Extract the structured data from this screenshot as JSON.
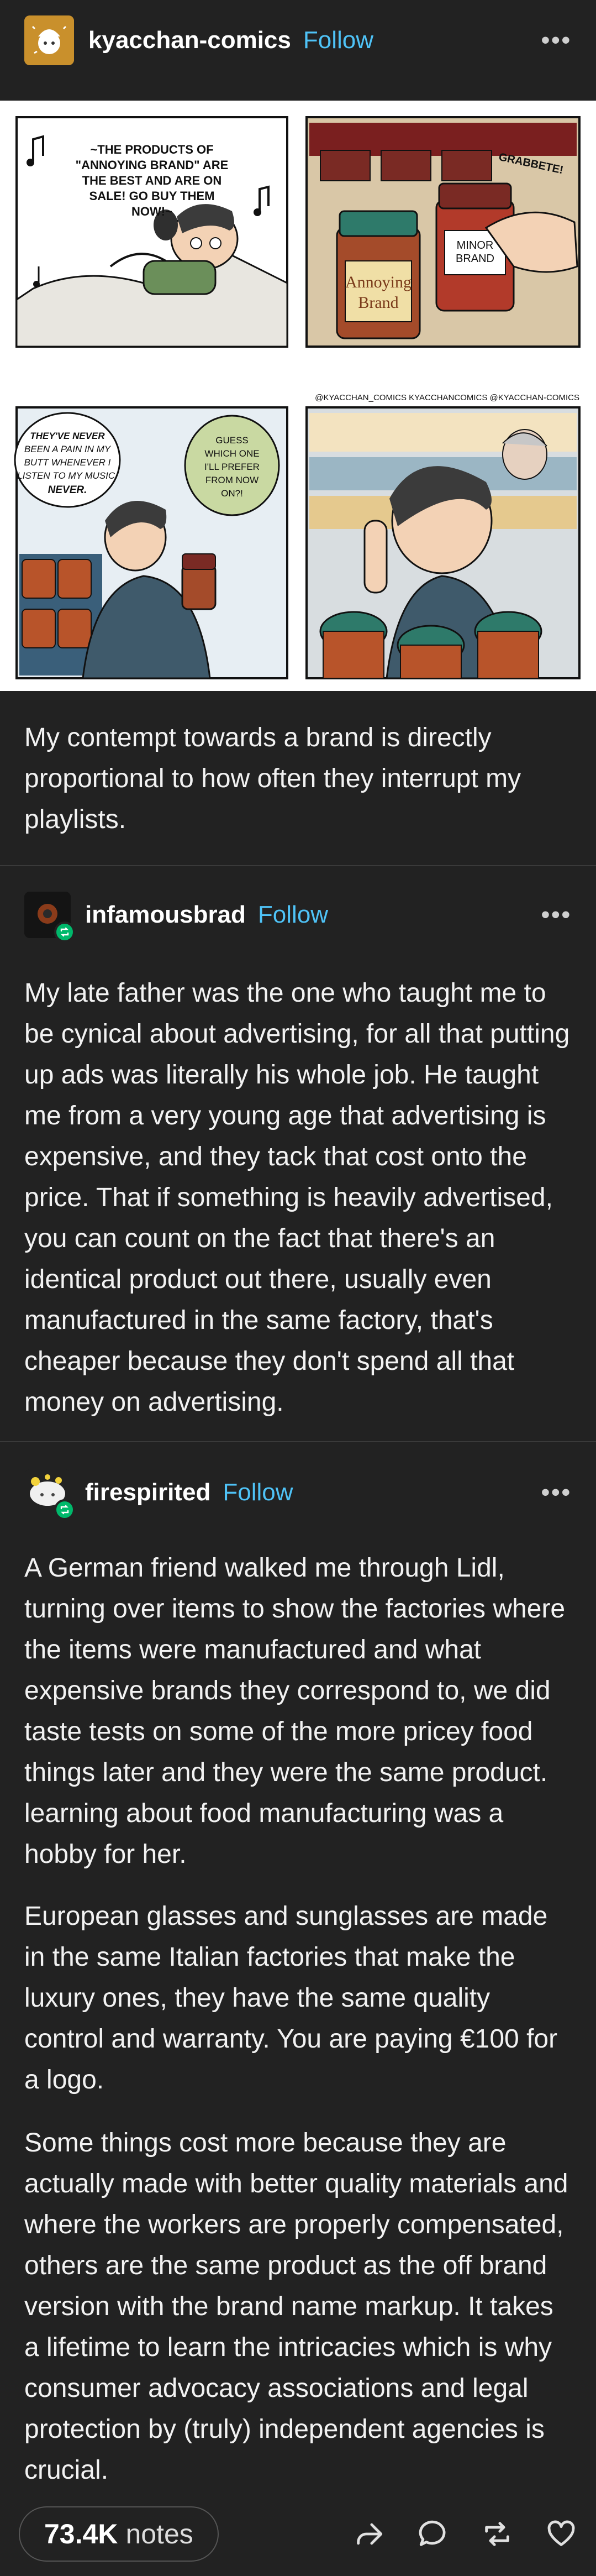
{
  "posts": [
    {
      "username": "kyacchan-comics",
      "follow_label": "Follow",
      "more_label": "•••",
      "comic": {
        "panel1_caption": [
          "~THE PRODUCTS OF",
          "\"ANNOYING BRAND\" ARE",
          "THE BEST AND ARE ON",
          "SALE! GO BUY THEM",
          "NOW!~"
        ],
        "panel2_sfx": "GRABBETE!",
        "panel2_minor_label": [
          "MINOR",
          "BRAND"
        ],
        "panel2_annoying_label": [
          "Annoying",
          "Brand"
        ],
        "credits": "@KYACCHAN_COMICS  KYACCHANCOMICS  @KYACCHAN-COMICS",
        "panel3_bubble1": [
          "THEY'VE NEVER",
          "BEEN A PAIN IN MY",
          "BUTT WHENEVER I",
          "LISTEN TO MY MUSIC.",
          "NEVER."
        ],
        "panel3_bubble2": [
          "GUESS",
          "WHICH ONE",
          "I'LL PREFER",
          "FROM NOW",
          "ON?!"
        ]
      },
      "text": "My contempt towards a brand is directly proportional to how often they interrupt my playlists."
    },
    {
      "username": "infamousbrad",
      "follow_label": "Follow",
      "more_label": "•••",
      "text": "My late father was the one who taught me to be cynical about advertising, for all that putting up ads was literally his whole job. He taught me from a very young age that advertising is expensive, and they tack that cost onto the price. That if something is heavily advertised, you can count on the fact that there's an identical product out there, usually even manufactured in the same factory, that's cheaper because they don't spend all that money on advertising."
    },
    {
      "username": "firespirited",
      "follow_label": "Follow",
      "more_label": "•••",
      "paragraphs": [
        "A German friend walked me through Lidl, turning over items to show the factories where the items were manufactured and what expensive brands they correspond to, we did taste tests on some of the more pricey food things later and they were the same product. learning about food manufacturing was a hobby for her.",
        "European glasses and sunglasses are made in the same Italian factories that make the luxury ones, they have the same quality control and warranty. You are paying €100 for a logo.",
        "Some things cost more because they are actually made with better quality materials and where the workers are properly compensated, others are the same product as the off brand version with the brand name markup. It takes a lifetime to learn the intricacies which is why consumer advocacy associations and legal protection by (truly) independent agencies is crucial."
      ]
    }
  ],
  "footer": {
    "notes_count": "73.4K",
    "notes_label": "notes",
    "icons": [
      "share-icon",
      "reply-icon",
      "reblog-icon",
      "like-icon"
    ]
  },
  "colors": {
    "background": "#222222",
    "follow": "#4fc3f7",
    "reblog_badge": "#00b86b"
  }
}
